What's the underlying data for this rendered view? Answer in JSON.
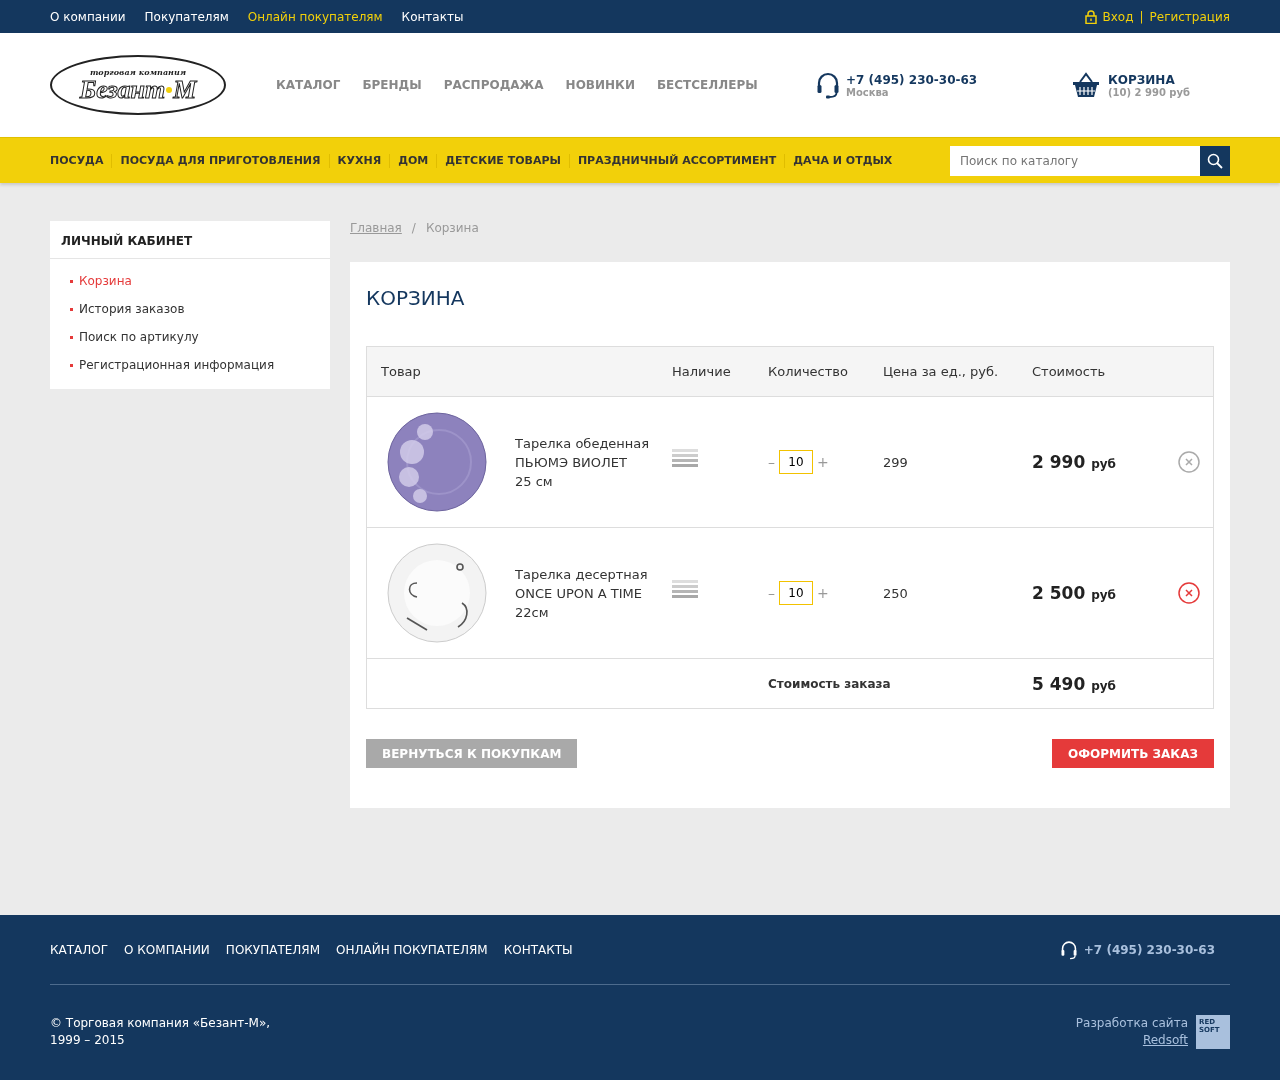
{
  "top_bar": {
    "links": [
      {
        "label": "О компании",
        "selected": false
      },
      {
        "label": "Покупателям",
        "selected": false
      },
      {
        "label": "Онлайн покупателям",
        "selected": true
      },
      {
        "label": "Контакты",
        "selected": false
      }
    ],
    "login": "Вход",
    "separator": "|",
    "register": "Регистрация"
  },
  "header": {
    "logo": {
      "tagline": "торговая компания",
      "name": "Безант",
      "suffix": "М"
    },
    "nav": [
      "КАТАЛОГ",
      "БРЕНДЫ",
      "РАСПРОДАЖА",
      "НОВИНКИ",
      "БЕСТСЕЛЛЕРЫ"
    ],
    "phone": {
      "number": "+7 (495) 230-30-63",
      "city": "Москва"
    },
    "cart": {
      "title": "КОРЗИНА",
      "summary": "(10) 2 990 руб"
    }
  },
  "category_bar": {
    "items": [
      "ПОСУДА",
      "ПОСУДА ДЛЯ ПРИГОТОВЛЕНИЯ",
      "КУХНЯ",
      "ДОМ",
      "ДЕТСКИЕ ТОВАРЫ",
      "ПРАЗДНИЧНЫЙ АССОРТИМЕНТ",
      "ДАЧА И ОТДЫХ"
    ],
    "search": {
      "placeholder": "Поиск по каталогу"
    }
  },
  "sidebar": {
    "title": "ЛИЧНЫЙ КАБИНЕТ",
    "items": [
      {
        "label": "Корзина",
        "selected": true
      },
      {
        "label": "История заказов",
        "selected": false
      },
      {
        "label": "Поиск по артикулу",
        "selected": false
      },
      {
        "label": "Регистрационная информация",
        "selected": false
      }
    ]
  },
  "breadcrumbs": [
    {
      "label": "Главная",
      "kind": "link"
    },
    {
      "label": "/",
      "kind": "separator"
    },
    {
      "label": "Корзина",
      "kind": "current"
    }
  ],
  "cart": {
    "title": "КОРЗИНА",
    "columns": [
      "Товар",
      "Наличие",
      "Количество",
      "Цена за ед., руб.",
      "Стоимость"
    ],
    "rows": [
      {
        "kind": "violet",
        "name": [
          "Тарелка обеденная",
          "ПЬЮМЭ ВИОЛЕТ",
          "25 см"
        ],
        "minus": "–",
        "quantity": "10",
        "plus": "+",
        "price": "299",
        "total": "2 990",
        "currency": "руб",
        "remove_hovered": false
      },
      {
        "kind": "white",
        "name": [
          "Тарелка десертная",
          "ONCE UPON A TIME",
          "22см"
        ],
        "minus": "–",
        "quantity": "10",
        "plus": "+",
        "price": "250",
        "total": "2 500",
        "currency": "руб",
        "remove_hovered": true
      }
    ],
    "summary": {
      "label": "Стоимость заказа",
      "total": "5 490",
      "currency": "руб"
    },
    "back_button": "ВЕРНУТЬСЯ К ПОКУПКАМ",
    "checkout_button": "ОФОРМИТЬ ЗАКАЗ"
  },
  "footer": {
    "links": [
      "КАТАЛОГ",
      "О КОМПАНИИ",
      "ПОКУПАТЕЛЯМ",
      "ОНЛАЙН ПОКУПАТЕЛЯМ",
      "КОНТАКТЫ"
    ],
    "phone": "+7 (495) 230-30-63",
    "copyright": [
      "© Торговая компания «Безант-М»,",
      "1999 – 2015"
    ],
    "developer": "Разработка сайта",
    "developer_link": "Redsoft",
    "developer_logo": [
      "RED",
      "SOFT"
    ]
  }
}
